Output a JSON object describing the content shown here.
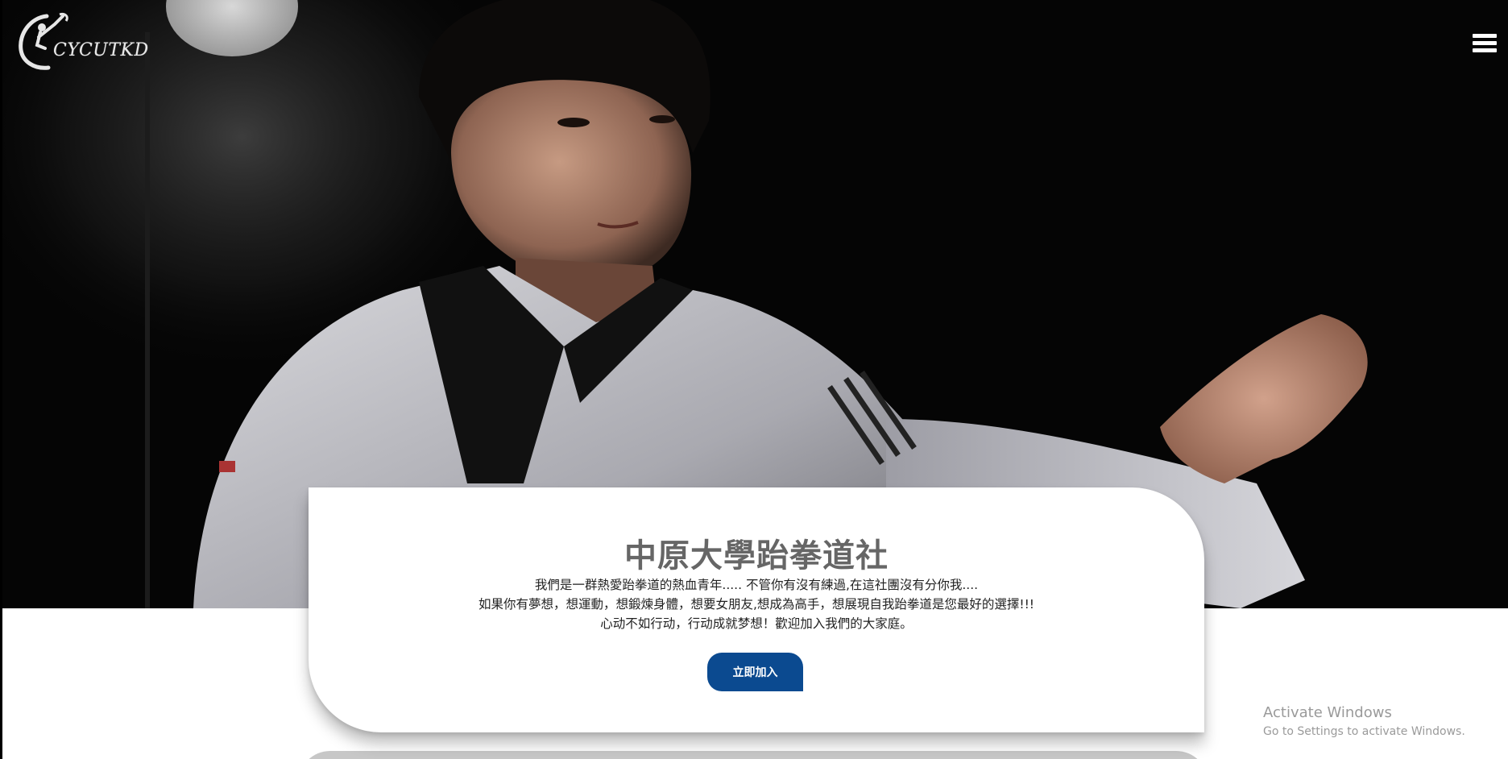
{
  "header": {
    "logo_text": "CYCUTKD"
  },
  "hero": {
    "image_alt": "taekwondo athlete in white dobok with black collar"
  },
  "intro": {
    "title": "中原大學跆拳道社",
    "line1": "我們是一群熱愛跆拳道的熱血青年..... 不管你有沒有練過,在這社團沒有分你我....",
    "line2": "如果你有夢想，想運動，想鍛煉身體，想要女朋友,想成為高手，想展現自我跆拳道是您最好的選擇!!!",
    "line3": "心动不如行动，行动成就梦想！歡迎加入我們的大家庭。",
    "join_label": "立即加入"
  },
  "watermark": {
    "title": "Activate Windows",
    "subtitle": "Go to Settings to activate Windows."
  },
  "colors": {
    "accent_button": "#0b4a90",
    "title_gray": "#666666",
    "hero_background": "#050505"
  },
  "icons": [
    "logo-icon",
    "hamburger-menu-icon"
  ]
}
